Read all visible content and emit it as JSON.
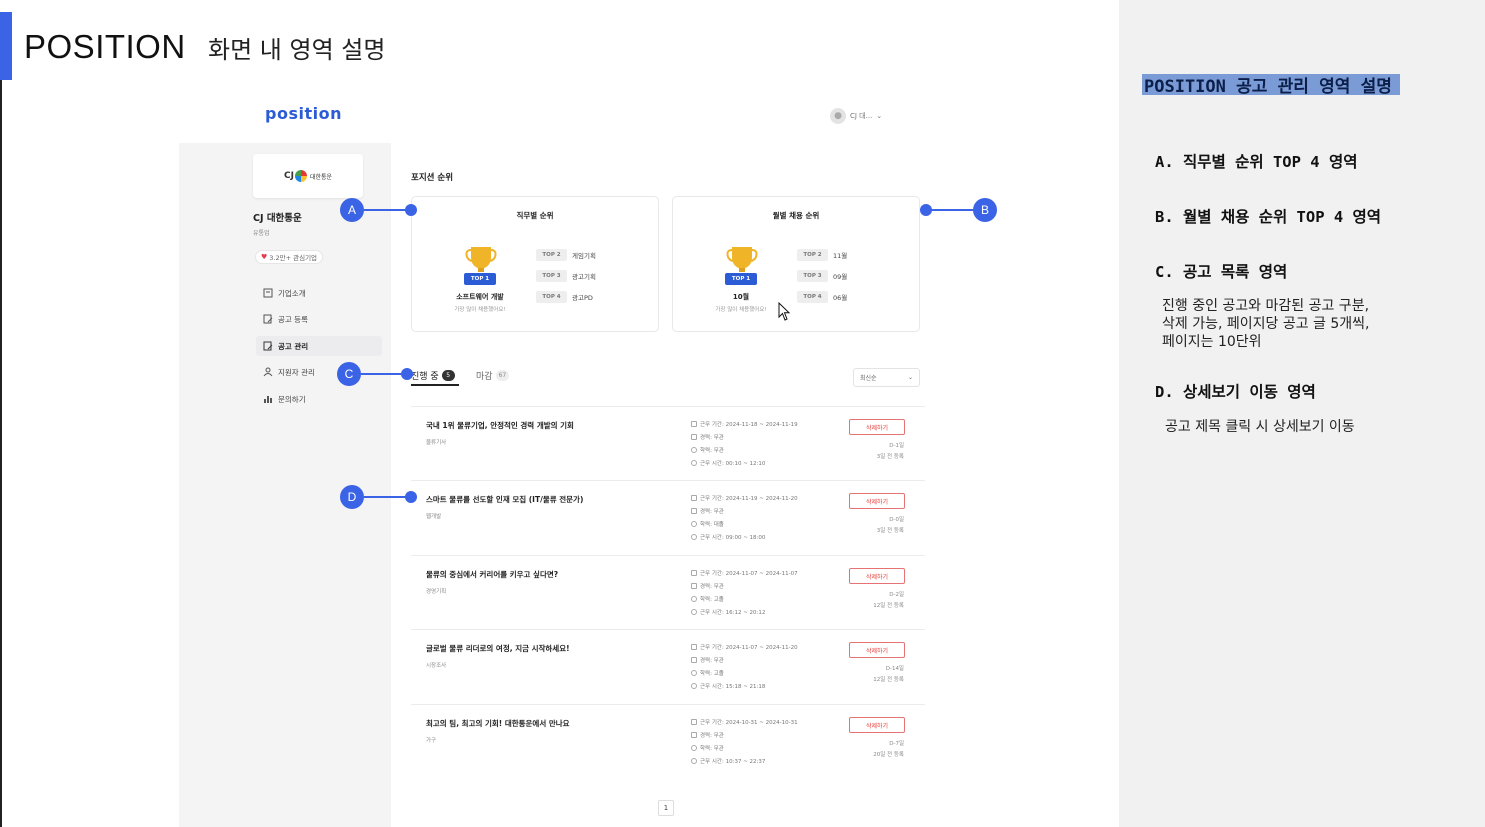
{
  "slide": {
    "title": "POSITION",
    "subtitle": "화면 내 영역 설명"
  },
  "site": {
    "logo": "position",
    "user": "CJ 대...",
    "company": {
      "logo_text": "CJ",
      "logo_name": "대한통운",
      "name": "CJ 대한통운",
      "type": "유통업",
      "fav": "3.2만+ 관심기업"
    },
    "sidebar": [
      {
        "label": "기업소개"
      },
      {
        "label": "공고 등록"
      },
      {
        "label": "공고 관리"
      },
      {
        "label": "지원자 관리"
      },
      {
        "label": "문의하기"
      }
    ],
    "rank_section_title": "포지션 순위",
    "job_rank": {
      "title": "직무별 순위",
      "top1_badge": "TOP 1",
      "top1_name": "소프트웨어 개발",
      "top1_sub": "가장 많이 채용했어요!",
      "others": [
        {
          "rank": "TOP 2",
          "label": "게임기획"
        },
        {
          "rank": "TOP 3",
          "label": "광고기획"
        },
        {
          "rank": "TOP 4",
          "label": "광고PD"
        }
      ]
    },
    "month_rank": {
      "title": "월별 채용 순위",
      "top1_badge": "TOP 1",
      "top1_name": "10월",
      "top1_sub": "가장 많이 채용했어요!",
      "others": [
        {
          "rank": "TOP 2",
          "label": "11월"
        },
        {
          "rank": "TOP 3",
          "label": "09월"
        },
        {
          "rank": "TOP 4",
          "label": "06월"
        }
      ]
    },
    "tabs": {
      "active_label": "진행 중",
      "active_count": "5",
      "closed_label": "마감",
      "closed_count": "67"
    },
    "sort": "최신순",
    "jobs": [
      {
        "title": "국내 1위 물류기업, 안정적인 경력 개발의 기회",
        "category": "물류기사",
        "period": "근무 기간: 2024-11-18 ~ 2024-11-19",
        "career": "경력: 무관",
        "education": "학력: 무관",
        "hours": "근무 시간: 00:10 ~ 12:10",
        "delete": "삭제하기",
        "dday": "D-1일",
        "posted": "3일 전 등록"
      },
      {
        "title": "스마트 물류를 선도할 인재 모집 (IT/물류 전문가)",
        "category": "웹개발",
        "period": "근무 기간: 2024-11-19 ~ 2024-11-20",
        "career": "경력: 무관",
        "education": "학력: 대졸",
        "hours": "근무 시간: 09:00 ~ 18:00",
        "delete": "삭제하기",
        "dday": "D-0일",
        "posted": "3일 전 등록"
      },
      {
        "title": "물류의 중심에서 커리어를 키우고 싶다면?",
        "category": "경영기획",
        "period": "근무 기간: 2024-11-07 ~ 2024-11-07",
        "career": "경력: 무관",
        "education": "학력: 고졸",
        "hours": "근무 시간: 16:12 ~ 20:12",
        "delete": "삭제하기",
        "dday": "D-2일",
        "posted": "12일 전 등록"
      },
      {
        "title": "글로벌 물류 리더로의 여정, 지금 시작하세요!",
        "category": "시장조사",
        "period": "근무 기간: 2024-11-07 ~ 2024-11-20",
        "career": "경력: 무관",
        "education": "학력: 고졸",
        "hours": "근무 시간: 15:18 ~ 21:18",
        "delete": "삭제하기",
        "dday": "D-14일",
        "posted": "12일 전 등록"
      },
      {
        "title": "최고의 팀, 최고의 기회! 대한통운에서 만나요",
        "category": "가구",
        "period": "근무 기간: 2024-10-31 ~ 2024-10-31",
        "career": "경력: 무관",
        "education": "학력: 무관",
        "hours": "근무 시간: 10:37 ~ 22:37",
        "delete": "삭제하기",
        "dday": "D-7일",
        "posted": "20일 전 등록"
      }
    ],
    "page": "1"
  },
  "markers": {
    "a": "A",
    "b": "B",
    "c": "C",
    "d": "D"
  },
  "panel": {
    "title": "POSITION 공고 관리 영역 설명",
    "a": "A. 직무별 순위 TOP 4 영역",
    "b": "B. 월별 채용 순위 TOP 4 영역",
    "c": "C. 공고 목록 영역",
    "c_desc": [
      "진행 중인 공고와 마감된 공고 구분,",
      "삭제 가능, 페이지당 공고 글 5개씩,",
      "페이지는 10단위"
    ],
    "d": "D. 상세보기 이동 영역",
    "d_desc": "공고 제목 클릭 시 상세보기 이동"
  },
  "colors": {
    "accent": "#3b63e6",
    "brand": "#2c5bd6",
    "panel_highlight": "#7b9bd6",
    "delete": "#e53935"
  }
}
